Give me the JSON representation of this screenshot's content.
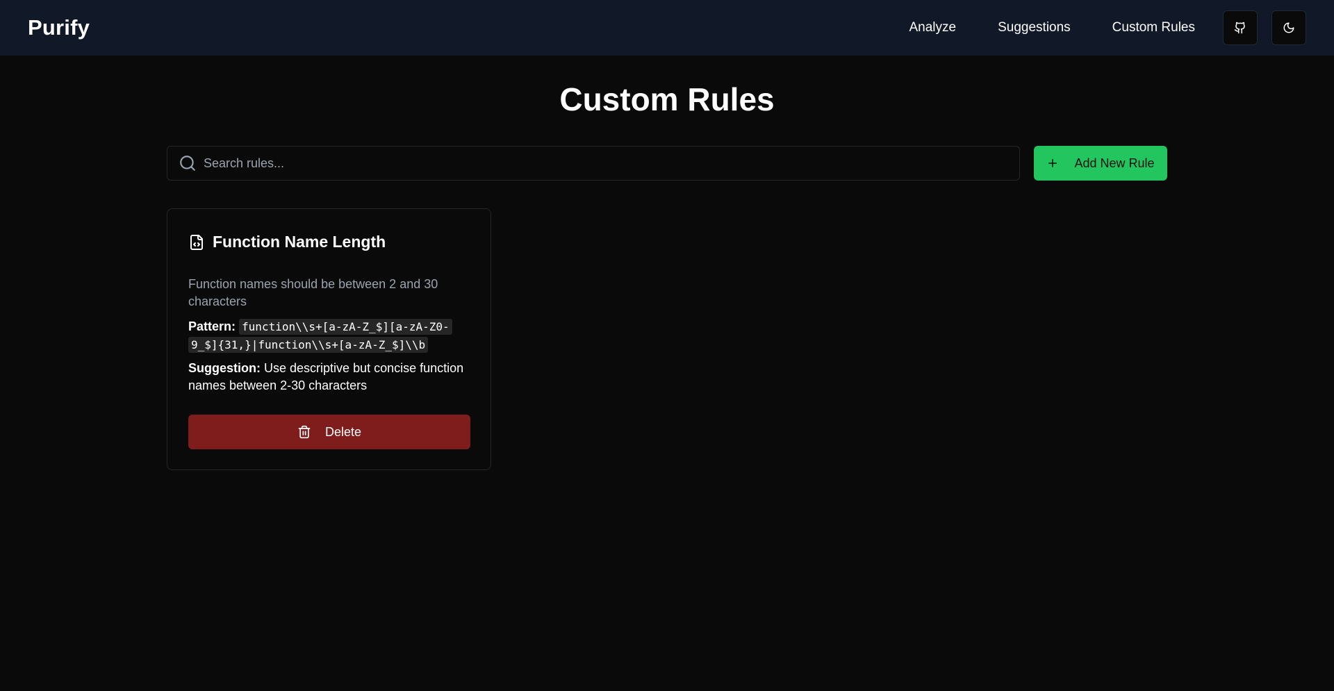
{
  "header": {
    "brand": "Purify",
    "nav": [
      {
        "label": "Analyze"
      },
      {
        "label": "Suggestions"
      },
      {
        "label": "Custom Rules"
      }
    ],
    "icons": {
      "github": "github-icon",
      "theme": "moon-icon"
    }
  },
  "page": {
    "title": "Custom Rules"
  },
  "search": {
    "placeholder": "Search rules...",
    "value": ""
  },
  "actions": {
    "add_label": "Add New Rule"
  },
  "rules": [
    {
      "title": "Function Name Length",
      "description": "Function names should be between 2 and 30 characters",
      "pattern_label": "Pattern:",
      "pattern": "function\\\\s+[a-zA-Z_$][a-zA-Z0-9_$]{31,}|function\\\\s+[a-zA-Z_$]\\\\b",
      "suggestion_label": "Suggestion:",
      "suggestion": "Use descriptive but concise function names between 2-30 characters",
      "delete_label": "Delete"
    }
  ],
  "colors": {
    "background": "#0a0a0a",
    "header": "#111827",
    "accent_green": "#22c55e",
    "danger": "#7f1d1d",
    "muted_text": "#9ca3af"
  }
}
